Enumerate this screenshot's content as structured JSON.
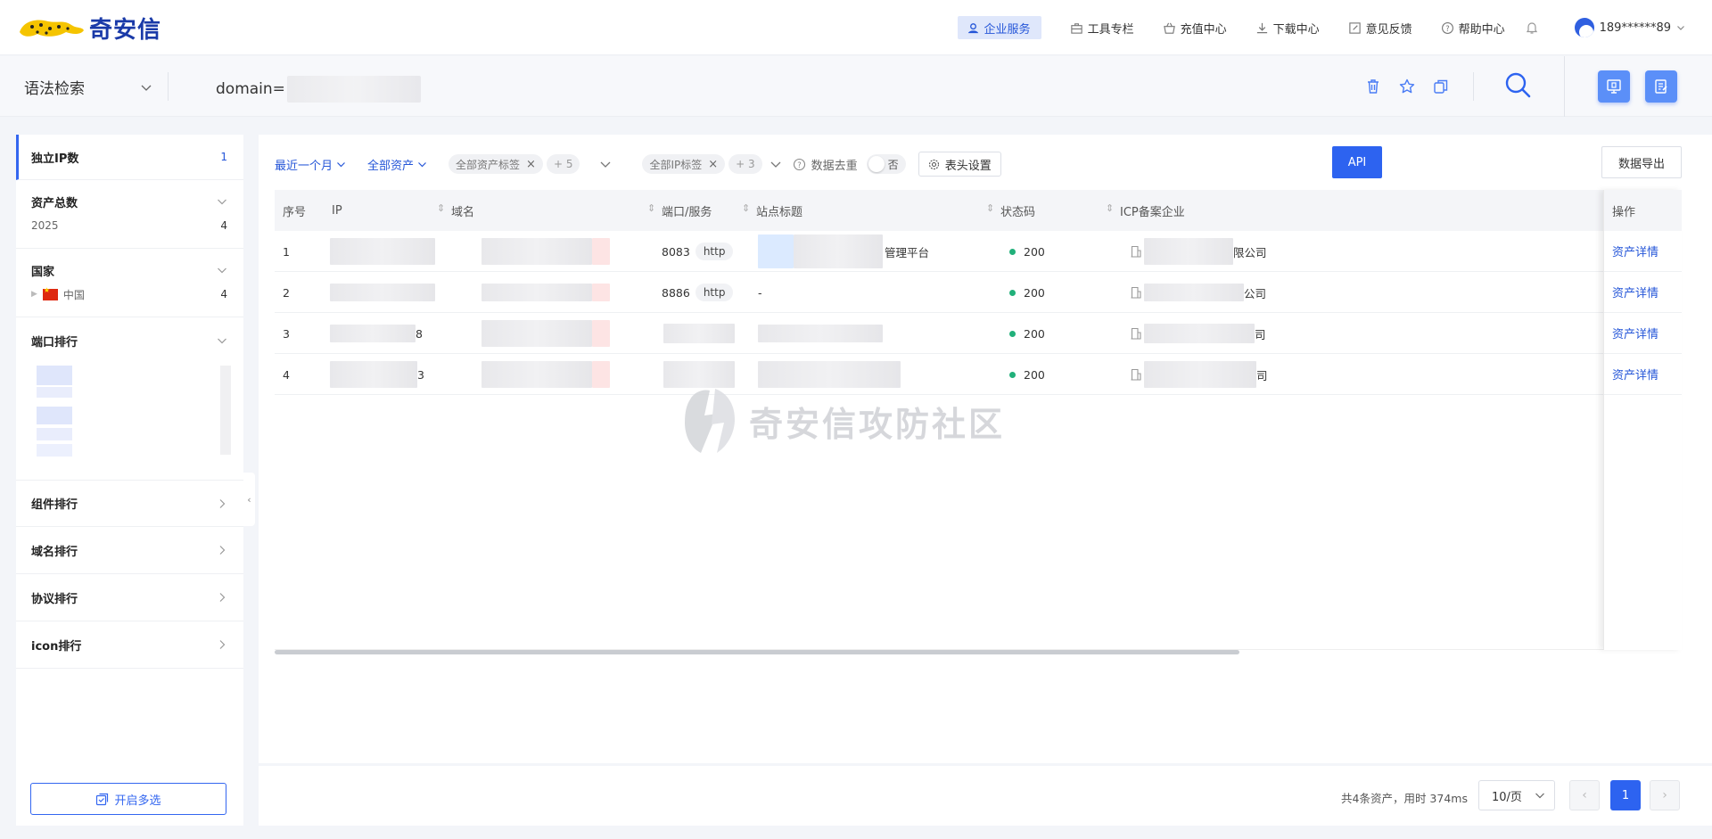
{
  "brand": {
    "name": "奇安信"
  },
  "nav": {
    "items": [
      {
        "label": "企业服务",
        "icon": "enterprise-icon"
      },
      {
        "label": "工具专栏",
        "icon": "toolbox-icon"
      },
      {
        "label": "充值中心",
        "icon": "basket-icon"
      },
      {
        "label": "下载中心",
        "icon": "download-icon"
      },
      {
        "label": "意见反馈",
        "icon": "feedback-icon"
      },
      {
        "label": "帮助中心",
        "icon": "help-icon"
      }
    ],
    "user": "189******89"
  },
  "search": {
    "type": "语法检索",
    "query_prefix": "domain="
  },
  "sidebar": {
    "ip_count": {
      "label": "独立IP数",
      "value": "1"
    },
    "asset_total": {
      "label": "资产总数",
      "rows": [
        {
          "label": "2025",
          "value": "4"
        }
      ]
    },
    "country": {
      "label": "国家",
      "rows": [
        {
          "label": "中国",
          "value": "4"
        }
      ]
    },
    "ports": {
      "label": "端口排行"
    },
    "components": {
      "label": "组件排行"
    },
    "domains": {
      "label": "域名排行"
    },
    "protocols": {
      "label": "协议排行"
    },
    "icons": {
      "label": "icon排行"
    },
    "multi_select": "开启多选",
    "accent": "#3366f0"
  },
  "filters": {
    "time": "最近一个月",
    "assets": "全部资产",
    "asset_tag": "全部资产标签",
    "asset_tag_more": "+ 5",
    "ip_tag": "全部IP标签",
    "ip_tag_more": "+ 3",
    "dedup": "数据去重",
    "dedup_value": "否",
    "column_settings": "表头设置",
    "api": "API",
    "export": "数据导出"
  },
  "table": {
    "headers": {
      "index": "序号",
      "ip": "IP",
      "domain": "域名",
      "port": "端口/服务",
      "title": "站点标题",
      "status": "状态码",
      "icp": "ICP备案企业",
      "ops": "操作"
    },
    "rows": [
      {
        "index": "1",
        "port": "8083",
        "service": "http",
        "title_suffix": "管理平台",
        "status": "200",
        "icp_suffix": "限公司",
        "op": "资产详情"
      },
      {
        "index": "2",
        "port": "8886",
        "service": "http",
        "title_suffix": "-",
        "status": "200",
        "icp_suffix": "公司",
        "op": "资产详情"
      },
      {
        "index": "3",
        "ip_suffix": "8",
        "status": "200",
        "icp_suffix": "司",
        "op": "资产详情"
      },
      {
        "index": "4",
        "ip_suffix": "3",
        "status": "200",
        "icp_suffix": "司",
        "op": "资产详情"
      }
    ],
    "status_color": "#21b07a"
  },
  "watermark": "奇安信攻防社区",
  "footer": {
    "summary": "共4条资产，用时 374ms",
    "page_size": "10/页",
    "current_page": "1"
  }
}
